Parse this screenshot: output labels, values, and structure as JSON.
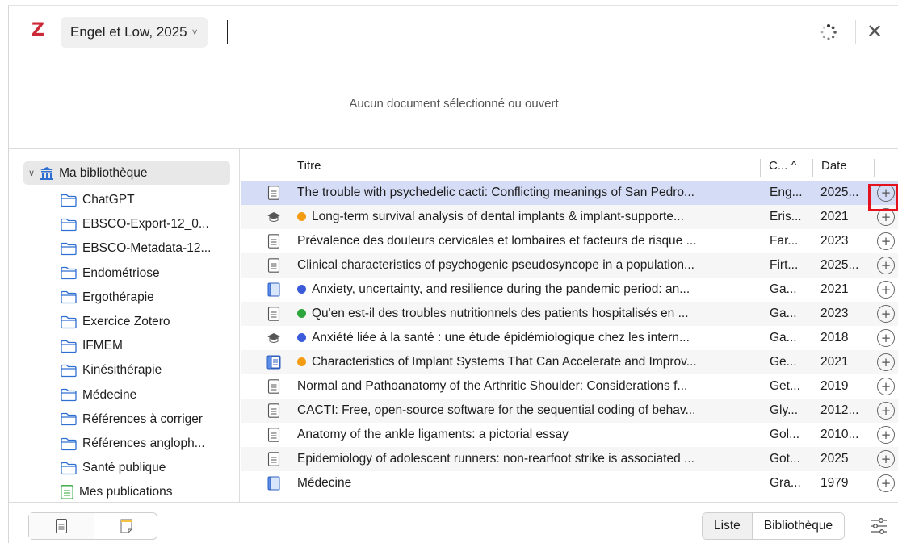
{
  "app": {
    "logo_letter": "Z"
  },
  "citation": {
    "text": "Engel et Low, 2025",
    "chevron": "˅"
  },
  "message": "Aucun document sélectionné ou ouvert",
  "sidebar": {
    "library": "Ma bibliothèque",
    "collections": [
      "ChatGPT",
      "EBSCO-Export-12_0...",
      "EBSCO-Metadata-12...",
      "Endométriose",
      "Ergothérapie",
      "Exercice Zotero",
      "IFMEM",
      "Kinésithérapie",
      "Médecine",
      "Références à corriger",
      "Références angloph...",
      "Santé publique"
    ],
    "publications": "Mes publications"
  },
  "columns": {
    "title": "Titre",
    "creator": "C...",
    "sort_indicator": "^",
    "date": "Date"
  },
  "colors": {
    "orange_tag": "#f39c12",
    "blue_tag": "#3b5bdb",
    "green_tag": "#2ca53a",
    "selection": "#d5dcf6",
    "zotero_red": "#cc2936",
    "highlight": "#e4121e"
  },
  "items": [
    {
      "icon": "document-icon",
      "tag": "",
      "title": "The trouble with psychedelic cacti: Conflicting meanings of San Pedro...",
      "creator": "Eng...",
      "date": "2025...",
      "selected": true
    },
    {
      "icon": "thesis-icon",
      "tag": "orange",
      "title": "Long-term survival analysis of dental implants & implant-supporte...",
      "creator": "Eris...",
      "date": "2021",
      "selected": false
    },
    {
      "icon": "document-icon",
      "tag": "",
      "title": "Prévalence des douleurs cervicales et lombaires et facteurs de risque ...",
      "creator": "Far...",
      "date": "2023",
      "selected": false
    },
    {
      "icon": "document-icon",
      "tag": "",
      "title": "Clinical characteristics of psychogenic pseudosyncope in a population...",
      "creator": "Firt...",
      "date": "2025...",
      "selected": false
    },
    {
      "icon": "book-icon",
      "tag": "blue",
      "title": "Anxiety, uncertainty, and resilience during the pandemic period: an...",
      "creator": "Ga...",
      "date": "2021",
      "selected": false
    },
    {
      "icon": "document-icon",
      "tag": "green",
      "title": "Qu'en est-il des troubles nutritionnels des patients hospitalisés en ...",
      "creator": "Ga...",
      "date": "2023",
      "selected": false
    },
    {
      "icon": "thesis-icon",
      "tag": "blue",
      "title": "Anxiété liée à la santé : une étude épidémiologique chez les intern...",
      "creator": "Ga...",
      "date": "2018",
      "selected": false
    },
    {
      "icon": "book-section-icon",
      "tag": "orange",
      "title": "Characteristics of Implant Systems That Can Accelerate and Improv...",
      "creator": "Ge...",
      "date": "2021",
      "selected": false
    },
    {
      "icon": "document-icon",
      "tag": "",
      "title": "Normal and Pathoanatomy of the Arthritic Shoulder: Considerations f...",
      "creator": "Get...",
      "date": "2019",
      "selected": false
    },
    {
      "icon": "document-icon",
      "tag": "",
      "title": "CACTI: Free, open-source software for the sequential coding of behav...",
      "creator": "Gly...",
      "date": "2012...",
      "selected": false
    },
    {
      "icon": "document-icon",
      "tag": "",
      "title": "Anatomy of the ankle ligaments: a pictorial essay",
      "creator": "Gol...",
      "date": "2010...",
      "selected": false
    },
    {
      "icon": "document-icon",
      "tag": "",
      "title": "Epidemiology of adolescent runners: non-rearfoot strike is associated ...",
      "creator": "Got...",
      "date": "2025",
      "selected": false
    },
    {
      "icon": "book-icon",
      "tag": "",
      "title": "Médecine",
      "creator": "Gra...",
      "date": "1979",
      "selected": false
    }
  ],
  "add_symbol": "+",
  "footer": {
    "view_toggle": [
      "Liste",
      "Bibliothèque"
    ],
    "active_view": "Bibliothèque"
  }
}
